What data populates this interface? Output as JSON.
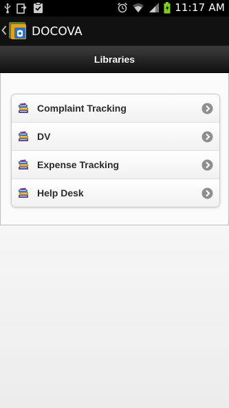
{
  "status_bar": {
    "time": "11:17 AM"
  },
  "app_bar": {
    "title": "DOCOVA"
  },
  "header": {
    "title": "Libraries"
  },
  "libraries": [
    {
      "label": "Complaint Tracking"
    },
    {
      "label": "DV"
    },
    {
      "label": "Expense Tracking"
    },
    {
      "label": "Help Desk"
    }
  ],
  "icons": {
    "library": "books-icon",
    "item_arrow": "chevron-right-circle-icon"
  },
  "colors": {
    "status_bar": "#000000",
    "header_gradient_top": "#3c3c3c",
    "header_gradient_bottom": "#111111",
    "arrow_circle": "#8e8e8e",
    "battery": "#7ed321"
  }
}
